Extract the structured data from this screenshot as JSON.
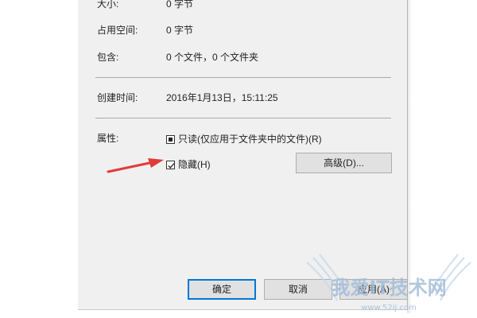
{
  "properties": {
    "size_label": "大小:",
    "size_value": "0 字节",
    "disk_size_label": "占用空间:",
    "disk_size_value": "0 字节",
    "contains_label": "包含:",
    "contains_value": "0 个文件，0 个文件夹",
    "created_label": "创建时间:",
    "created_value": "2016年1月13日，15:11:25",
    "attributes_label": "属性:"
  },
  "attributes": {
    "readonly_label": "只读(仅应用于文件夹中的文件)(R)",
    "readonly_state": "indeterminate",
    "hidden_label": "隐藏(H)",
    "hidden_checked": true,
    "advanced_button": "高级(D)..."
  },
  "footer": {
    "ok_label": "确定",
    "cancel_label": "取消",
    "apply_label": "应用(A)"
  },
  "watermark": {
    "text": "我爱IT技术网",
    "url": "www.52ij.com"
  },
  "colors": {
    "accent": "#0078d7",
    "arrow": "#e23a3a",
    "dialog_bg": "#f0f0f0"
  },
  "icons": {
    "arrow": "red-pointer-arrow-icon",
    "checkmark": "checkmark-icon"
  }
}
